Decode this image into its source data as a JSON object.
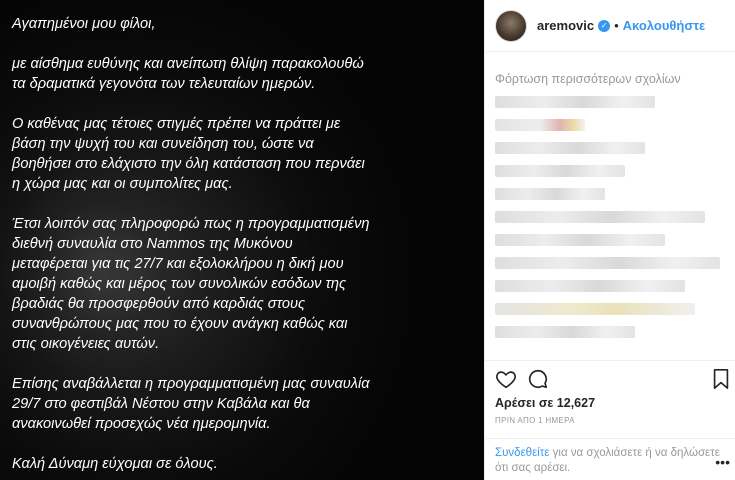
{
  "post": {
    "paragraphs": [
      "Αγαπημένοι μου φίλοι,",
      "με αίσθημα ευθύνης και ανείπωτη θλίψη παρακολουθώ\nτα δραματικά γεγονότα των τελευταίων ημερών.",
      "Ο καθένας μας τέτοιες στιγμές πρέπει να πράττει με\nβάση την ψυχή του και συνείδηση του, ώστε να\nβοηθήσει στο ελάχιστο την όλη κατάσταση που περνάει\nη χώρα μας και οι συμπολίτες μας.",
      "Έτσι λοιπόν σας πληροφορώ πως η προγραμματισμένη\nδιεθνή συναυλία στο Nammos της Μυκόνου\nμεταφέρεται για τις 27/7 και εξολοκλήρου η δική μου\nαμοιβή καθώς και μέρος των συνολικών εσόδων της\nβραδιάς θα προσφερθούν από καρδιάς στους\nσυνανθρώπους μας που το έχουν ανάγκη καθώς και\nστις οικογένειες αυτών.",
      "Επίσης αναβάλλεται η προγραμματισμένη μας συναυλία\n29/7 στο φεστιβάλ Νέστου στην Καβάλα και θα\nανακοινωθεί προσεχώς νέα ημερομηνία.",
      "Καλή Δύναμη εύχομαι σε όλους."
    ]
  },
  "header": {
    "username": "aremovic",
    "separator": "•",
    "follow_label": "Ακολουθήστε",
    "verified_icon": "verified-badge-icon"
  },
  "comments": {
    "load_more_label": "Φόρτωση περισσότερων σχολίων"
  },
  "actions": {
    "like_icon": "heart-icon",
    "comment_icon": "comment-icon",
    "save_icon": "bookmark-icon",
    "likes_text": "Αρέσει σε 12,627",
    "time_text": "ΠΡΙΝ ΑΠΟ 1 ΗΜΕΡΑ"
  },
  "login": {
    "link_text": "Συνδεθείτε",
    "rest_text": " για να σχολιάσετε ή να δηλώσετε ότι σας αρέσει.",
    "more_icon": "more-dots-icon"
  },
  "colors": {
    "accent": "#3897f0",
    "muted": "#999999",
    "text": "#262626"
  }
}
